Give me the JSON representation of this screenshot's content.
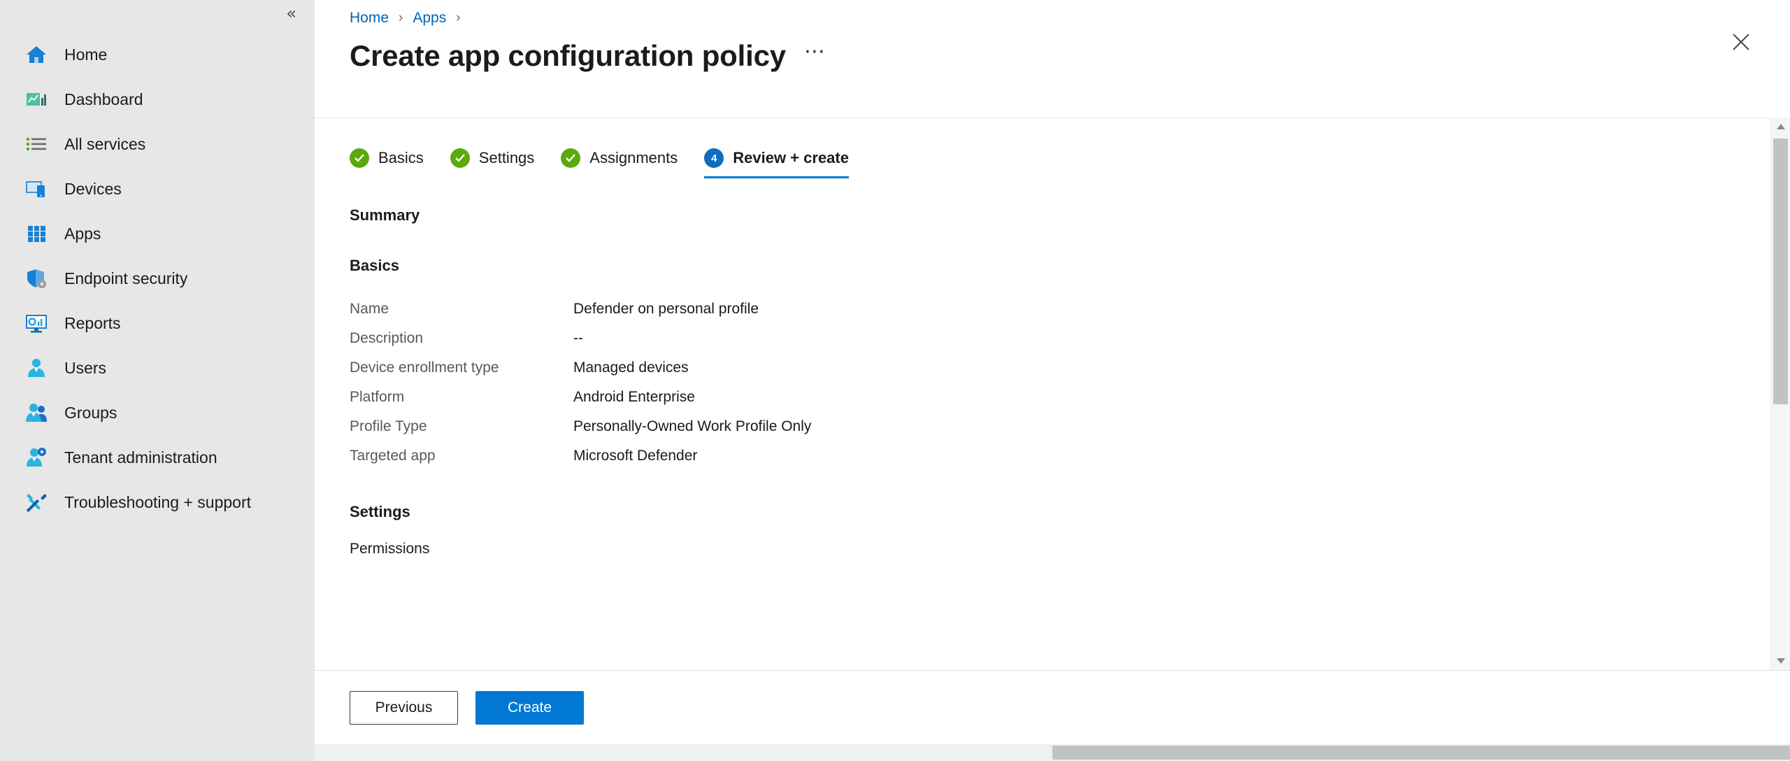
{
  "sidebar": {
    "collapse_glyph": "«",
    "items": [
      {
        "label": "Home",
        "icon": "home-icon"
      },
      {
        "label": "Dashboard",
        "icon": "dashboard-icon"
      },
      {
        "label": "All services",
        "icon": "all-services-icon"
      },
      {
        "label": "Devices",
        "icon": "devices-icon"
      },
      {
        "label": "Apps",
        "icon": "apps-grid-icon"
      },
      {
        "label": "Endpoint security",
        "icon": "shield-gear-icon"
      },
      {
        "label": "Reports",
        "icon": "reports-monitor-icon"
      },
      {
        "label": "Users",
        "icon": "user-icon"
      },
      {
        "label": "Groups",
        "icon": "groups-icon"
      },
      {
        "label": "Tenant administration",
        "icon": "user-gear-icon"
      },
      {
        "label": "Troubleshooting + support",
        "icon": "wrench-screwdriver-icon"
      }
    ]
  },
  "breadcrumb": {
    "items": [
      "Home",
      "Apps"
    ],
    "separator": "›"
  },
  "header": {
    "title": "Create app configuration policy",
    "ellipsis": "⋯",
    "close_glyph": "✕"
  },
  "wizard": {
    "tabs": [
      {
        "label": "Basics",
        "state": "done",
        "badge": "✓"
      },
      {
        "label": "Settings",
        "state": "done",
        "badge": "✓"
      },
      {
        "label": "Assignments",
        "state": "done",
        "badge": "✓"
      },
      {
        "label": "Review + create",
        "state": "active",
        "badge": "4"
      }
    ]
  },
  "summary": {
    "heading": "Summary",
    "basics": {
      "heading": "Basics",
      "rows": [
        {
          "key": "Name",
          "value": "Defender on personal profile"
        },
        {
          "key": "Description",
          "value": "--"
        },
        {
          "key": "Device enrollment type",
          "value": "Managed devices"
        },
        {
          "key": "Platform",
          "value": "Android Enterprise"
        },
        {
          "key": "Profile Type",
          "value": "Personally-Owned Work Profile Only"
        },
        {
          "key": "Targeted app",
          "value": "Microsoft Defender"
        }
      ]
    },
    "settings": {
      "heading": "Settings",
      "permissions_label": "Permissions"
    }
  },
  "footer": {
    "previous_label": "Previous",
    "create_label": "Create"
  },
  "scrollbar": {
    "up_glyph": "▲",
    "down_glyph": "▼"
  },
  "colors": {
    "accent": "#0078d4",
    "link": "#0065b3",
    "success": "#5aaa0a",
    "badge": "#0f6cbd",
    "sidebar_bg": "#e7e7e7"
  }
}
